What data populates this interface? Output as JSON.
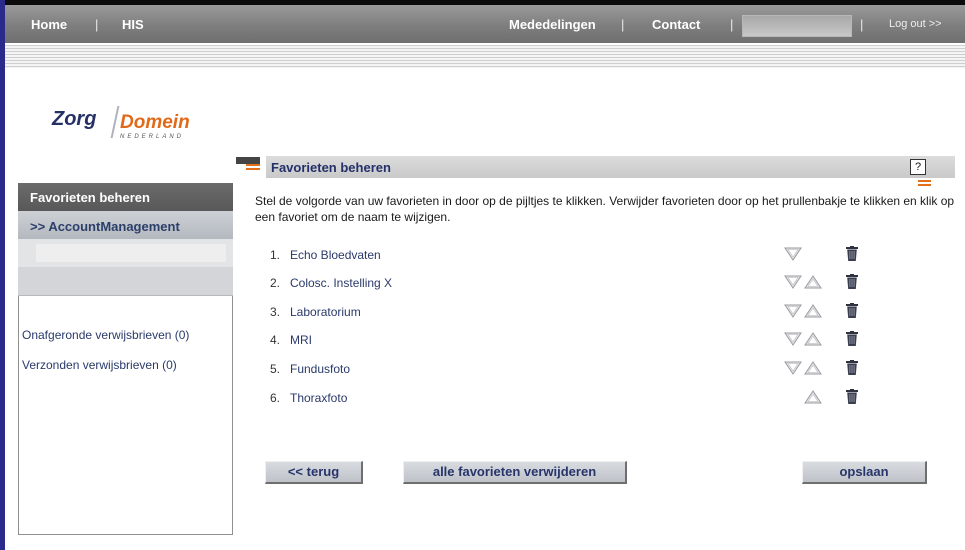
{
  "topnav": {
    "home": "Home",
    "his": "HIS",
    "separator": "|",
    "mededelingen": "Mededelingen",
    "contact": "Contact",
    "logout": "Log out >>"
  },
  "logo": {
    "zorg": "Zorg",
    "domein": "Domein",
    "nederland": "NEDERLAND"
  },
  "sidebar": {
    "active_item": "Favorieten beheren",
    "account_item": ">> AccountManagement",
    "links": [
      "Onafgeronde verwijsbrieven (0)",
      "Verzonden verwijsbrieven (0)"
    ]
  },
  "header": {
    "title": "Favorieten beheren",
    "help": "?"
  },
  "instructions": "Stel de volgorde van uw favorieten in door op de pijltjes te klikken. Verwijder favorieten door op het prullenbakje te klikken en klik op een favoriet om de naam te wijzigen.",
  "favorites": [
    {
      "num": "1.",
      "name": "Echo Bloedvaten",
      "down": true,
      "up": false
    },
    {
      "num": "2.",
      "name": "Colosc. Instelling X",
      "down": true,
      "up": true
    },
    {
      "num": "3.",
      "name": "Laboratorium",
      "down": true,
      "up": true
    },
    {
      "num": "4.",
      "name": "MRI",
      "down": true,
      "up": true
    },
    {
      "num": "5.",
      "name": "Fundusfoto",
      "down": true,
      "up": true
    },
    {
      "num": "6.",
      "name": "Thoraxfoto",
      "down": false,
      "up": true
    }
  ],
  "buttons": {
    "back": "<< terug",
    "delete_all": "alle favorieten verwijderen",
    "save": "opslaan"
  },
  "colors": {
    "accent_orange": "#e2701a",
    "nav_gray": "#7e7e7e",
    "link_navy": "#2a3a6a"
  }
}
